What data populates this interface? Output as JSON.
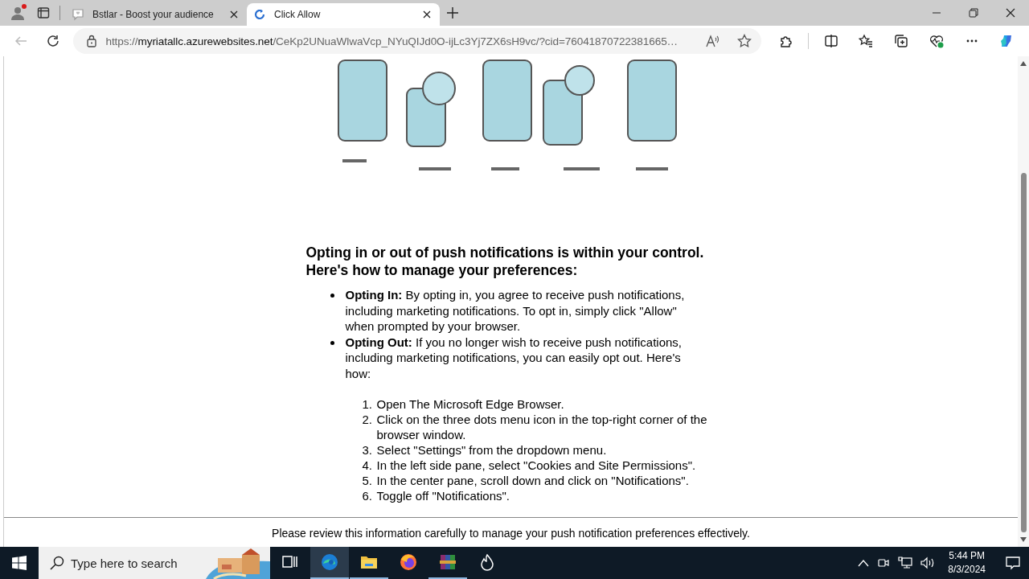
{
  "tabs": [
    {
      "kind": "chat",
      "title": "Bstlar - Boost your audience",
      "selected": false
    },
    {
      "kind": "spinner",
      "title": "Click Allow",
      "selected": true
    }
  ],
  "profile": {
    "notification_dot": true
  },
  "address_bar": {
    "back_disabled": true,
    "scheme": "https://",
    "host": "myriatallc.azurewebsites.net",
    "path": "/CeKp2UNuaWlwaVcp_NYuQIJd0O-ijLc3Yj7ZX6sH9vc/?cid=76041870722381665…"
  },
  "page": {
    "heading": [
      "Opting in or out of push notifications is within your control.",
      "Here's how to manage your preferences:"
    ],
    "bullets": [
      {
        "text": "**Opting In:** By opting in, you agree to receive push notifications, including marketing notifications. To opt in, simply click \"Allow\" when prompted by your browser."
      },
      {
        "text": "**Opting Out:** If you no longer wish to receive push notifications, including marketing notifications, you can easily opt out. Here's how:"
      }
    ],
    "steps": [
      {
        "number": "1.",
        "text": "Open The Microsoft Edge Browser."
      },
      {
        "number": "2.",
        "text": "Click on the three dots menu icon in the top-right corner of the browser window."
      },
      {
        "number": "3.",
        "text": "Select \"Settings\" from the dropdown menu."
      },
      {
        "number": "4.",
        "text": "In the left side pane, select \"Cookies and Site Permissions\"."
      },
      {
        "number": "5.",
        "text": "In the center pane, scroll down and click on \"Notifications\"."
      },
      {
        "number": "6.",
        "text": "Toggle off \"Notifications\"."
      }
    ],
    "footer": "Please review this information carefully to manage your push notification preferences effectively."
  },
  "taskbar": {
    "search_placeholder": "Type here to search",
    "apps": [
      {
        "kind": "taskview",
        "running": false,
        "selected": false
      },
      {
        "kind": "edge",
        "running": true,
        "selected": true
      },
      {
        "kind": "folder",
        "running": true,
        "selected": false
      },
      {
        "kind": "firefox",
        "running": false,
        "selected": false
      },
      {
        "kind": "archive",
        "running": true,
        "selected": false
      },
      {
        "kind": "flame",
        "running": false,
        "selected": false
      }
    ],
    "time": "5:44 PM",
    "date": "8/3/2024"
  }
}
